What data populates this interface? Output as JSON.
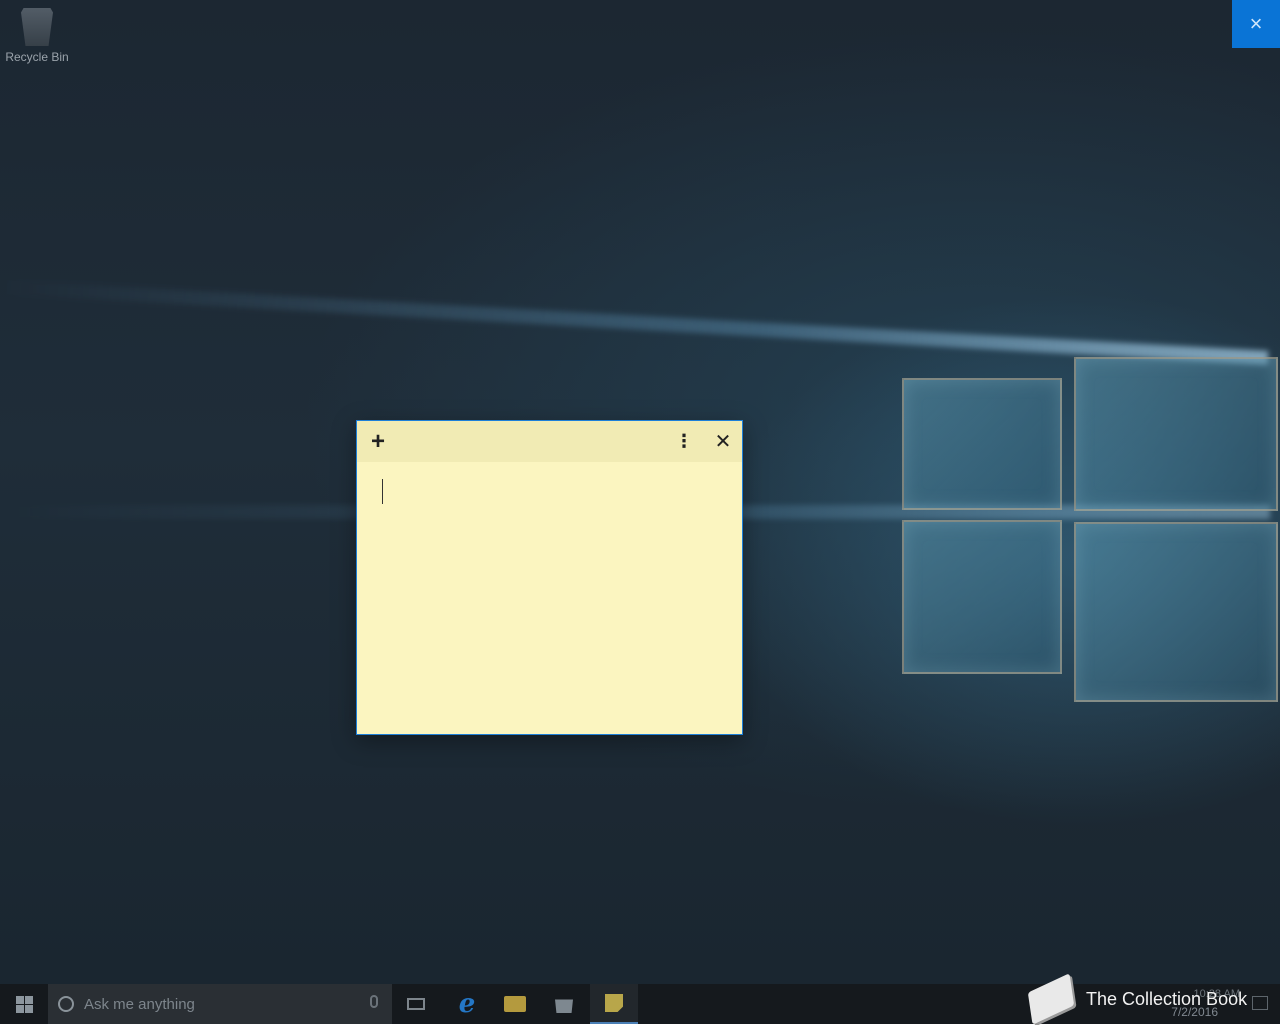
{
  "desktop": {
    "recycle_bin_label": "Recycle Bin",
    "overlay_close_icon": "×"
  },
  "sticky_note": {
    "add_icon": "+",
    "menu_icon": "⋮",
    "close_icon": "✕",
    "text": "",
    "background_color": "#fbf5c0",
    "header_color": "#f1ebb4"
  },
  "taskbar": {
    "search_placeholder": "Ask me anything",
    "icons": [
      "windows-start-icon",
      "cortana-icon",
      "microphone-icon",
      "task-view-icon",
      "edge-icon",
      "file-explorer-icon",
      "store-icon",
      "sticky-notes-icon"
    ],
    "clock_time": "10:28 AM",
    "clock_date": "7/2/2016"
  },
  "watermark": {
    "text": "The Collection Book"
  }
}
